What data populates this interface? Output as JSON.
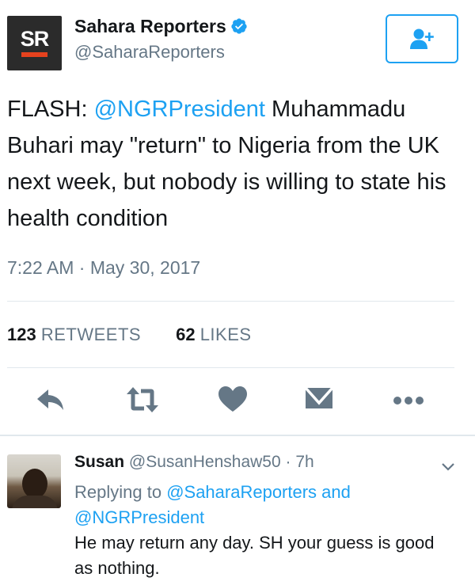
{
  "tweet": {
    "logo_text": "SR",
    "display_name": "Sahara Reporters",
    "handle": "@SaharaReporters",
    "text_prefix": "FLASH: ",
    "mention": "@NGRPresident",
    "text_rest": " Muhammadu Buhari may \"return\" to Nigeria from the UK next week, but nobody is willing to state his health condition",
    "timestamp": "7:22 AM · May 30, 2017",
    "retweets_count": "123",
    "retweets_label": "RETWEETS",
    "likes_count": "62",
    "likes_label": "LIKES",
    "verified_icon": "verified-badge-icon",
    "follow_icon": "add-user-icon"
  },
  "actions": [
    {
      "name": "reply",
      "icon": "reply-icon"
    },
    {
      "name": "retweet",
      "icon": "retweet-icon"
    },
    {
      "name": "like",
      "icon": "heart-icon"
    },
    {
      "name": "message",
      "icon": "envelope-icon"
    },
    {
      "name": "more",
      "icon": "more-dots-icon"
    }
  ],
  "reply": {
    "name": "Susan",
    "handle": "@SusanHenshaw50",
    "separator": " · ",
    "time": "7h",
    "replying_prefix": "Replying to ",
    "replying_to_1": "@SaharaReporters",
    "replying_and": " and",
    "replying_to_2": "@NGRPresident",
    "text": "He may return any day. SH your guess is good as nothing.",
    "menu_icon": "chevron-down-icon"
  },
  "colors": {
    "accent": "#1da1f2",
    "secondary_text": "#657786",
    "icon_gray": "#657786",
    "logo_bg": "#2b2b2b",
    "logo_bar": "#e5421e"
  }
}
